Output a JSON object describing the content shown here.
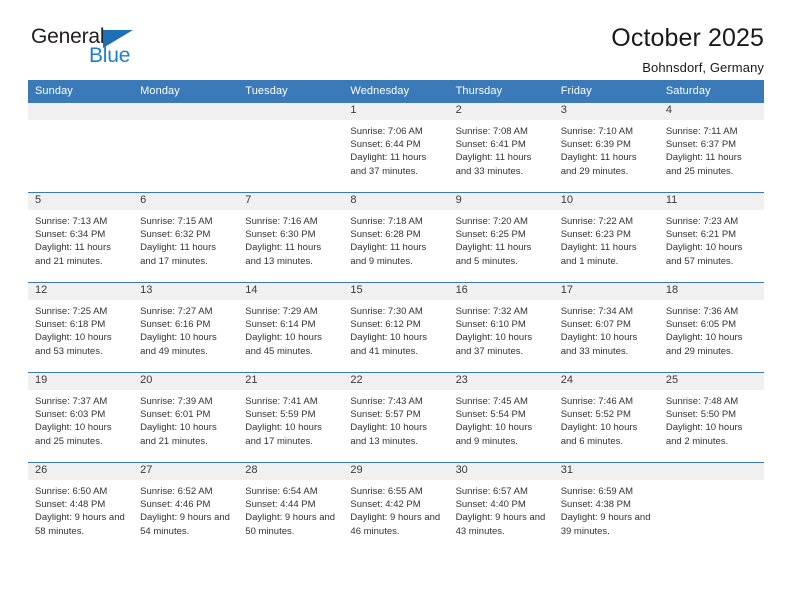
{
  "logo": {
    "word_top": "General",
    "word_bottom": "Blue",
    "triangle_color": "#1f6fb5",
    "blue_text_color": "#1f7fd0"
  },
  "header": {
    "title": "October 2025",
    "subtitle": "Bohnsdorf, Germany"
  },
  "theme": {
    "header_blue": "#3a7ab8",
    "daynum_band": "#f0f0f0",
    "text": "#333333"
  },
  "calendar": {
    "weekday_headers": [
      "Sunday",
      "Monday",
      "Tuesday",
      "Wednesday",
      "Thursday",
      "Friday",
      "Saturday"
    ],
    "weeks": [
      [
        {
          "day": "",
          "empty": true,
          "sunrise": "",
          "sunset": "",
          "daylight": ""
        },
        {
          "day": "",
          "empty": true,
          "sunrise": "",
          "sunset": "",
          "daylight": ""
        },
        {
          "day": "",
          "empty": true,
          "sunrise": "",
          "sunset": "",
          "daylight": ""
        },
        {
          "day": "1",
          "empty": false,
          "sunrise": "Sunrise: 7:06 AM",
          "sunset": "Sunset: 6:44 PM",
          "daylight": "Daylight: 11 hours and 37 minutes."
        },
        {
          "day": "2",
          "empty": false,
          "sunrise": "Sunrise: 7:08 AM",
          "sunset": "Sunset: 6:41 PM",
          "daylight": "Daylight: 11 hours and 33 minutes."
        },
        {
          "day": "3",
          "empty": false,
          "sunrise": "Sunrise: 7:10 AM",
          "sunset": "Sunset: 6:39 PM",
          "daylight": "Daylight: 11 hours and 29 minutes."
        },
        {
          "day": "4",
          "empty": false,
          "sunrise": "Sunrise: 7:11 AM",
          "sunset": "Sunset: 6:37 PM",
          "daylight": "Daylight: 11 hours and 25 minutes."
        }
      ],
      [
        {
          "day": "5",
          "empty": false,
          "sunrise": "Sunrise: 7:13 AM",
          "sunset": "Sunset: 6:34 PM",
          "daylight": "Daylight: 11 hours and 21 minutes."
        },
        {
          "day": "6",
          "empty": false,
          "sunrise": "Sunrise: 7:15 AM",
          "sunset": "Sunset: 6:32 PM",
          "daylight": "Daylight: 11 hours and 17 minutes."
        },
        {
          "day": "7",
          "empty": false,
          "sunrise": "Sunrise: 7:16 AM",
          "sunset": "Sunset: 6:30 PM",
          "daylight": "Daylight: 11 hours and 13 minutes."
        },
        {
          "day": "8",
          "empty": false,
          "sunrise": "Sunrise: 7:18 AM",
          "sunset": "Sunset: 6:28 PM",
          "daylight": "Daylight: 11 hours and 9 minutes."
        },
        {
          "day": "9",
          "empty": false,
          "sunrise": "Sunrise: 7:20 AM",
          "sunset": "Sunset: 6:25 PM",
          "daylight": "Daylight: 11 hours and 5 minutes."
        },
        {
          "day": "10",
          "empty": false,
          "sunrise": "Sunrise: 7:22 AM",
          "sunset": "Sunset: 6:23 PM",
          "daylight": "Daylight: 11 hours and 1 minute."
        },
        {
          "day": "11",
          "empty": false,
          "sunrise": "Sunrise: 7:23 AM",
          "sunset": "Sunset: 6:21 PM",
          "daylight": "Daylight: 10 hours and 57 minutes."
        }
      ],
      [
        {
          "day": "12",
          "empty": false,
          "sunrise": "Sunrise: 7:25 AM",
          "sunset": "Sunset: 6:18 PM",
          "daylight": "Daylight: 10 hours and 53 minutes."
        },
        {
          "day": "13",
          "empty": false,
          "sunrise": "Sunrise: 7:27 AM",
          "sunset": "Sunset: 6:16 PM",
          "daylight": "Daylight: 10 hours and 49 minutes."
        },
        {
          "day": "14",
          "empty": false,
          "sunrise": "Sunrise: 7:29 AM",
          "sunset": "Sunset: 6:14 PM",
          "daylight": "Daylight: 10 hours and 45 minutes."
        },
        {
          "day": "15",
          "empty": false,
          "sunrise": "Sunrise: 7:30 AM",
          "sunset": "Sunset: 6:12 PM",
          "daylight": "Daylight: 10 hours and 41 minutes."
        },
        {
          "day": "16",
          "empty": false,
          "sunrise": "Sunrise: 7:32 AM",
          "sunset": "Sunset: 6:10 PM",
          "daylight": "Daylight: 10 hours and 37 minutes."
        },
        {
          "day": "17",
          "empty": false,
          "sunrise": "Sunrise: 7:34 AM",
          "sunset": "Sunset: 6:07 PM",
          "daylight": "Daylight: 10 hours and 33 minutes."
        },
        {
          "day": "18",
          "empty": false,
          "sunrise": "Sunrise: 7:36 AM",
          "sunset": "Sunset: 6:05 PM",
          "daylight": "Daylight: 10 hours and 29 minutes."
        }
      ],
      [
        {
          "day": "19",
          "empty": false,
          "sunrise": "Sunrise: 7:37 AM",
          "sunset": "Sunset: 6:03 PM",
          "daylight": "Daylight: 10 hours and 25 minutes."
        },
        {
          "day": "20",
          "empty": false,
          "sunrise": "Sunrise: 7:39 AM",
          "sunset": "Sunset: 6:01 PM",
          "daylight": "Daylight: 10 hours and 21 minutes."
        },
        {
          "day": "21",
          "empty": false,
          "sunrise": "Sunrise: 7:41 AM",
          "sunset": "Sunset: 5:59 PM",
          "daylight": "Daylight: 10 hours and 17 minutes."
        },
        {
          "day": "22",
          "empty": false,
          "sunrise": "Sunrise: 7:43 AM",
          "sunset": "Sunset: 5:57 PM",
          "daylight": "Daylight: 10 hours and 13 minutes."
        },
        {
          "day": "23",
          "empty": false,
          "sunrise": "Sunrise: 7:45 AM",
          "sunset": "Sunset: 5:54 PM",
          "daylight": "Daylight: 10 hours and 9 minutes."
        },
        {
          "day": "24",
          "empty": false,
          "sunrise": "Sunrise: 7:46 AM",
          "sunset": "Sunset: 5:52 PM",
          "daylight": "Daylight: 10 hours and 6 minutes."
        },
        {
          "day": "25",
          "empty": false,
          "sunrise": "Sunrise: 7:48 AM",
          "sunset": "Sunset: 5:50 PM",
          "daylight": "Daylight: 10 hours and 2 minutes."
        }
      ],
      [
        {
          "day": "26",
          "empty": false,
          "sunrise": "Sunrise: 6:50 AM",
          "sunset": "Sunset: 4:48 PM",
          "daylight": "Daylight: 9 hours and 58 minutes."
        },
        {
          "day": "27",
          "empty": false,
          "sunrise": "Sunrise: 6:52 AM",
          "sunset": "Sunset: 4:46 PM",
          "daylight": "Daylight: 9 hours and 54 minutes."
        },
        {
          "day": "28",
          "empty": false,
          "sunrise": "Sunrise: 6:54 AM",
          "sunset": "Sunset: 4:44 PM",
          "daylight": "Daylight: 9 hours and 50 minutes."
        },
        {
          "day": "29",
          "empty": false,
          "sunrise": "Sunrise: 6:55 AM",
          "sunset": "Sunset: 4:42 PM",
          "daylight": "Daylight: 9 hours and 46 minutes."
        },
        {
          "day": "30",
          "empty": false,
          "sunrise": "Sunrise: 6:57 AM",
          "sunset": "Sunset: 4:40 PM",
          "daylight": "Daylight: 9 hours and 43 minutes."
        },
        {
          "day": "31",
          "empty": false,
          "sunrise": "Sunrise: 6:59 AM",
          "sunset": "Sunset: 4:38 PM",
          "daylight": "Daylight: 9 hours and 39 minutes."
        },
        {
          "day": "",
          "empty": true,
          "sunrise": "",
          "sunset": "",
          "daylight": ""
        }
      ]
    ]
  }
}
